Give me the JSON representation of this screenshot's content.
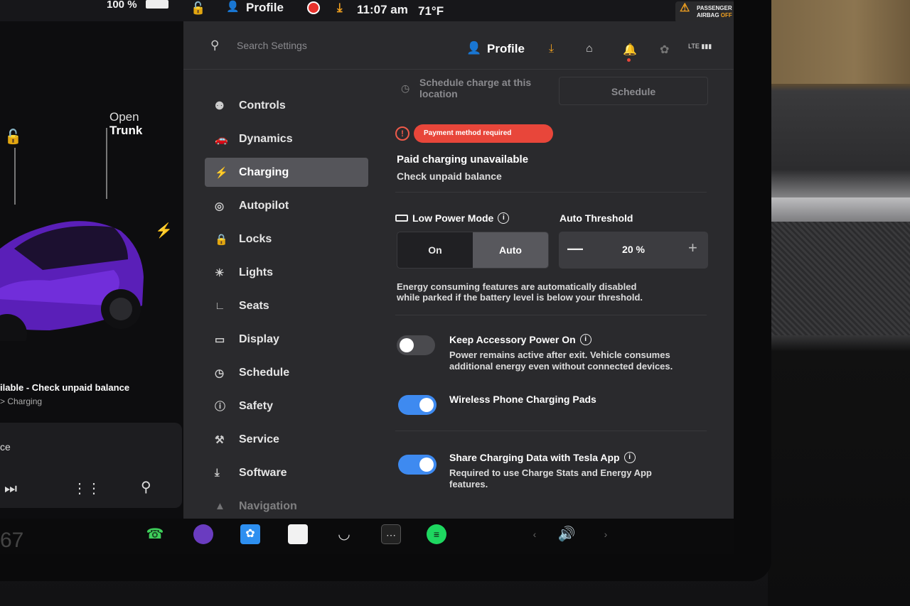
{
  "status_bar": {
    "battery_percent": "100 %",
    "profile": "Profile",
    "time": "11:07 am",
    "temperature": "71°F",
    "airbag_line1": "PASSENGER",
    "airbag_line2": "AIRBAG",
    "airbag_state": "OFF"
  },
  "car_panel": {
    "open_trunk_line1": "Open",
    "open_trunk_line2": "Trunk",
    "status_text": "ilable - Check unpaid balance",
    "status_sub": "> Charging",
    "media_text": "ce"
  },
  "header": {
    "search_placeholder": "Search Settings",
    "profile_label": "Profile"
  },
  "nav": {
    "items": [
      {
        "label": "Controls",
        "icon": "toggle-icon"
      },
      {
        "label": "Dynamics",
        "icon": "car-icon"
      },
      {
        "label": "Charging",
        "icon": "bolt-icon",
        "active": true
      },
      {
        "label": "Autopilot",
        "icon": "steering-wheel-icon"
      },
      {
        "label": "Locks",
        "icon": "lock-icon"
      },
      {
        "label": "Lights",
        "icon": "sun-icon"
      },
      {
        "label": "Seats",
        "icon": "seat-icon"
      },
      {
        "label": "Display",
        "icon": "display-icon"
      },
      {
        "label": "Schedule",
        "icon": "alarm-clock-icon"
      },
      {
        "label": "Safety",
        "icon": "alert-circle-icon"
      },
      {
        "label": "Service",
        "icon": "wrench-icon"
      },
      {
        "label": "Software",
        "icon": "download-icon"
      },
      {
        "label": "Navigation",
        "icon": "navigation-arrow-icon"
      }
    ]
  },
  "charging": {
    "schedule_label_line1": "Schedule charge at this",
    "schedule_label_line2": "location",
    "schedule_button": "Schedule",
    "payment_pill": "Payment method required",
    "paid_title": "Paid charging unavailable",
    "paid_sub": "Check unpaid balance",
    "low_power_title": "Low Power Mode",
    "auto_threshold_title": "Auto Threshold",
    "mode_options": [
      "On",
      "Auto"
    ],
    "mode_selected": "Auto",
    "threshold_value": "20 %",
    "energy_desc_line1": "Energy consuming features are automatically disabled",
    "energy_desc_line2": "while parked if the battery level is below your threshold.",
    "accessory_title": "Keep Accessory Power On",
    "accessory_desc_line1": "Power remains active after exit. Vehicle consumes",
    "accessory_desc_line2": "additional energy even without connected devices.",
    "accessory_on": false,
    "wireless_title": "Wireless Phone Charging Pads",
    "wireless_on": true,
    "share_title": "Share Charging Data with Tesla App",
    "share_desc_line1": "Required to use Charge Stats and Energy App",
    "share_desc_line2": "features.",
    "share_on": true
  },
  "dock": {
    "speed_fragment": "67",
    "icons": [
      "phone-icon",
      "camera-icon",
      "bluetooth-icon",
      "notes-icon",
      "wiper-icon",
      "more-icon",
      "spotify-icon",
      "volume-icon"
    ]
  },
  "colors": {
    "accent_blue": "#3e8af0",
    "warning_red": "#e8463a",
    "download_orange": "#f0a020"
  }
}
